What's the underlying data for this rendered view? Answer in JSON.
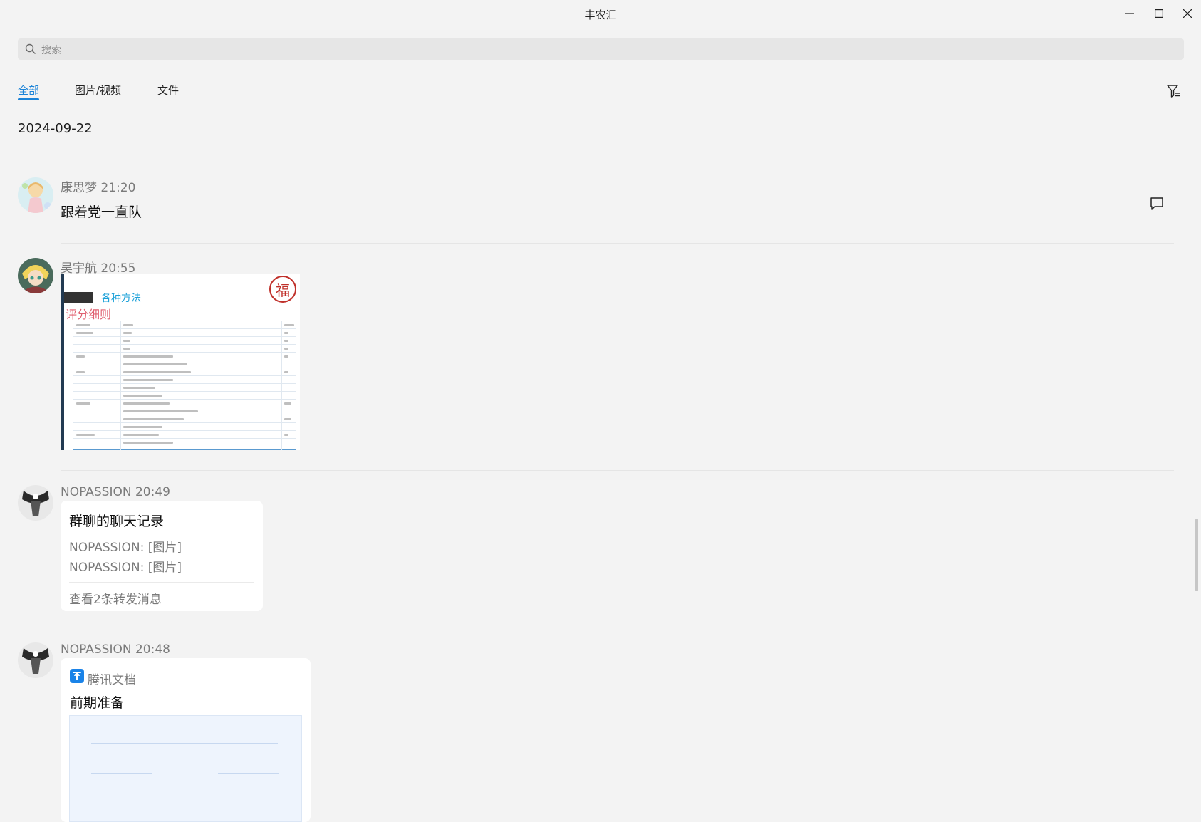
{
  "window": {
    "title": "丰农汇"
  },
  "search": {
    "placeholder": "搜索"
  },
  "tabs": [
    {
      "label": "全部",
      "active": true
    },
    {
      "label": "图片/视频",
      "active": false
    },
    {
      "label": "文件",
      "active": false
    }
  ],
  "date_header": "2024-09-22",
  "messages": [
    {
      "sender": "康思梦",
      "time": "21:20",
      "meta": "康思梦 21:20",
      "text": "跟着党一直队"
    },
    {
      "sender": "吴宇航",
      "time": "20:55",
      "meta": "吴宇航 20:55",
      "image": {
        "heading": "各种方法",
        "subheading": "评分细则",
        "seal": "福"
      }
    },
    {
      "sender": "NOPASSION",
      "time": "20:49",
      "meta": "NOPASSION 20:49",
      "forward": {
        "title": "群聊的聊天记录",
        "lines": [
          "NOPASSION: [图片]",
          "NOPASSION: [图片]"
        ],
        "footer": "查看2条转发消息"
      }
    },
    {
      "sender": "NOPASSION",
      "time": "20:48",
      "meta": "NOPASSION 20:48",
      "doc": {
        "app": "腾讯文档",
        "name": "前期准备"
      }
    }
  ],
  "colors": {
    "accent": "#1a83d8",
    "background": "#f3f3f3",
    "card": "#ffffff"
  }
}
